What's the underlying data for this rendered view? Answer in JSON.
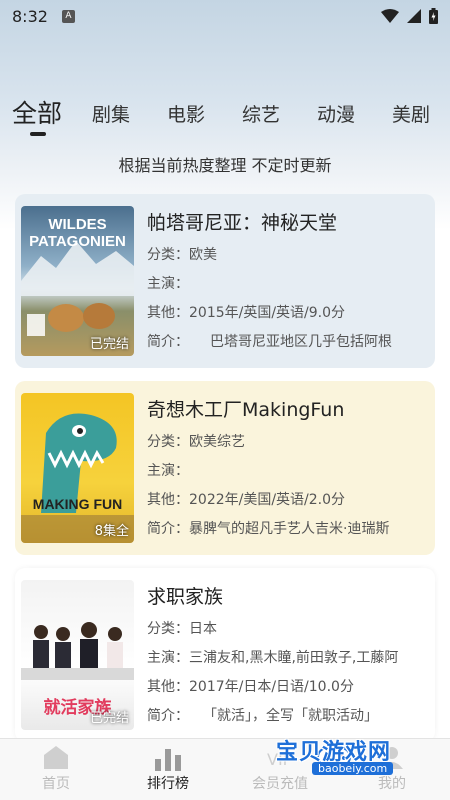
{
  "status_bar": {
    "time": "8:32",
    "notification_icon": "a-letter-icon",
    "icons": [
      "wifi-icon",
      "signal-icon",
      "battery-icon"
    ]
  },
  "tabs": [
    {
      "label": "全部",
      "active": true
    },
    {
      "label": "剧集",
      "active": false
    },
    {
      "label": "电影",
      "active": false
    },
    {
      "label": "综艺",
      "active": false
    },
    {
      "label": "动漫",
      "active": false
    },
    {
      "label": "美剧",
      "active": false
    }
  ],
  "subtitle": "根据当前热度整理 不定时更新",
  "cards": [
    {
      "title": "帕塔哥尼亚：神秘天堂",
      "badge": "已完结",
      "poster_text": "WILDES PATAGONIEN",
      "category_label": "分类：",
      "category": "欧美",
      "cast_label": "主演：",
      "cast": "",
      "other_label": "其他：",
      "other": "2015年/英国/英语/9.0分",
      "intro_label": "简介：",
      "intro": "　　巴塔哥尼亚地区几乎包括阿根",
      "bg": "#e6edf3"
    },
    {
      "title": "奇想木工厂MakingFun",
      "badge": "8集全",
      "poster_text": "MAKING FUN",
      "category_label": "分类：",
      "category": "欧美综艺",
      "cast_label": "主演：",
      "cast": "",
      "other_label": "其他：",
      "other": "2022年/美国/英语/2.0分",
      "intro_label": "简介：",
      "intro": "暴脾气的超凡手艺人吉米·迪瑞斯",
      "bg": "#faf4dc"
    },
    {
      "title": "求职家族",
      "badge": "已完结",
      "poster_text": "就活家族",
      "category_label": "分类：",
      "category": "日本",
      "cast_label": "主演：",
      "cast": "三浦友和,黑木瞳,前田敦子,工藤阿",
      "other_label": "其他：",
      "other": "2017年/日本/日语/10.0分",
      "intro_label": "简介：",
      "intro": "　　「就活」，全写「就职活动」",
      "bg": "#ffffff"
    }
  ],
  "bottom_nav": [
    {
      "label": "首页",
      "icon": "home-icon",
      "active": false
    },
    {
      "label": "排行榜",
      "icon": "ranking-icon",
      "active": true
    },
    {
      "label": "会员充值",
      "icon": "vip-icon",
      "active": false
    },
    {
      "label": "我的",
      "icon": "profile-icon",
      "active": false
    }
  ],
  "watermark": {
    "text": "宝贝游戏网",
    "url": "baobeiy.com"
  }
}
